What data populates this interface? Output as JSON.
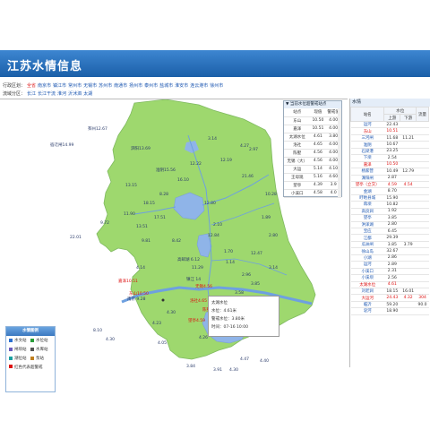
{
  "app": {
    "title": "江苏水情信息"
  },
  "nav": {
    "region_label": "行政区划：",
    "regions": [
      "全省",
      "南京市",
      "镇江市",
      "常州市",
      "无锡市",
      "苏州市",
      "南通市",
      "扬州市",
      "泰州市",
      "盐城市",
      "淮安市",
      "连云港市",
      "徐州市"
    ],
    "active_region": "全省",
    "basin_label": "流域分区：",
    "basins": [
      "长江",
      "长江干流",
      "淮河",
      "沂沭泗",
      "太湖"
    ]
  },
  "popup": {
    "title": "▼ 当前水位超警戒站点",
    "headers": [
      "站点",
      "现值",
      "警戒值"
    ],
    "rows": [
      [
        "东山",
        "10.50",
        "4.00"
      ],
      [
        "嘉泽",
        "10.51",
        "4.00"
      ],
      [
        "太湖水位",
        "4.61",
        "3.80"
      ],
      [
        "洛社",
        "4.65",
        "4.00"
      ],
      [
        "陈墅",
        "4.56",
        "4.00"
      ],
      [
        "无锡（大）",
        "4.56",
        "4.00"
      ],
      [
        "大运",
        "5.14",
        "4.10"
      ],
      [
        "王母观",
        "5.16",
        "4.60"
      ],
      [
        "望亭",
        "4.39",
        "3.9"
      ],
      [
        "小溪口",
        "4.58",
        "4.0"
      ]
    ]
  },
  "tooltip": {
    "name": "太湖水位",
    "level_label": "水位：",
    "level": "4.61米",
    "warn_label": "警戒水位：",
    "warn": "3.80米",
    "time_label": "时间：",
    "time": "07-16 10:00"
  },
  "legend": {
    "title": "水情图例",
    "items": [
      {
        "label": "水文站",
        "color": "#2a6fd0"
      },
      {
        "label": "水位站",
        "color": "#2a9d3a"
      },
      {
        "label": "闸坝站",
        "color": "#6a5bbd"
      },
      {
        "label": "水库站",
        "color": "#555555"
      },
      {
        "label": "潮位站",
        "color": "#1aa0a0"
      },
      {
        "label": "泵站",
        "color": "#c08020"
      }
    ],
    "note": "红色代表超警戒"
  },
  "sidebar": {
    "title": "水情",
    "headers": [
      "站名",
      "水位",
      "上游",
      "下游",
      "流量"
    ],
    "rows": [
      {
        "name": "运河",
        "up": "22.43",
        "down": "",
        "flow": "",
        "red": false
      },
      {
        "name": "东山",
        "up": "10.51",
        "down": "",
        "flow": "",
        "red": true
      },
      {
        "name": "三河闸",
        "up": "11.68",
        "down": "11.21",
        "flow": "",
        "red": false
      },
      {
        "name": "淮阴",
        "up": "10.67",
        "down": "",
        "flow": "",
        "red": false
      },
      {
        "name": "石梁港",
        "up": "23.25",
        "down": "",
        "flow": "",
        "red": false
      },
      {
        "name": "下坝",
        "up": "2.54",
        "down": "",
        "flow": "",
        "red": false
      },
      {
        "name": "嘉泽",
        "up": "10.50",
        "down": "",
        "flow": "",
        "red": true
      },
      {
        "name": "杨家营",
        "up": "10.49",
        "down": "12.79",
        "flow": "",
        "red": false
      },
      {
        "name": "溧阳闸",
        "up": "2.87",
        "down": "",
        "flow": "",
        "red": false
      },
      {
        "name": "望亭（立交）",
        "up": "4.59",
        "down": "4.54",
        "flow": "",
        "red": true
      },
      {
        "name": "金湖",
        "up": "8.70",
        "down": "",
        "flow": "",
        "red": false
      },
      {
        "name": "盱眙县城",
        "up": "15.90",
        "down": "",
        "flow": "",
        "red": false
      },
      {
        "name": "蒋坝",
        "up": "10.82",
        "down": "",
        "flow": "",
        "red": false
      },
      {
        "name": "高良涧",
        "up": "1.92",
        "down": "",
        "flow": "",
        "red": false
      },
      {
        "name": "望亭",
        "up": "3.85",
        "down": "",
        "flow": "",
        "red": false
      },
      {
        "name": "洪泽湖",
        "up": "2.80",
        "down": "",
        "flow": "",
        "red": false
      },
      {
        "name": "宝应",
        "up": "6.45",
        "down": "",
        "flow": "",
        "red": false
      },
      {
        "name": "江都",
        "up": "29.39",
        "down": "",
        "flow": "",
        "red": false
      },
      {
        "name": "瓜洲闸",
        "up": "3.85",
        "down": "3.79",
        "flow": "",
        "red": false
      },
      {
        "name": "徐山岛",
        "up": "32.67",
        "down": "",
        "flow": "",
        "red": false
      },
      {
        "name": "小湖",
        "up": "2.86",
        "down": "",
        "flow": "",
        "red": false
      },
      {
        "name": "运河",
        "up": "2.89",
        "down": "",
        "flow": "",
        "red": false
      },
      {
        "name": "小溪口",
        "up": "2.31",
        "down": "",
        "flow": "",
        "red": false
      },
      {
        "name": "小溪坝",
        "up": "2.56",
        "down": "",
        "flow": "",
        "red": false
      },
      {
        "name": "太湖水位",
        "up": "4.61",
        "down": "",
        "flow": "",
        "red": true
      },
      {
        "name": "刘老涧",
        "up": "18.15",
        "down": "16.01",
        "flow": "",
        "red": false
      },
      {
        "name": "大运河",
        "up": "24.43",
        "down": "4.32",
        "flow": "304",
        "red": true
      },
      {
        "name": "临沂",
        "up": "59.20",
        "down": "",
        "flow": "90.0",
        "red": false
      },
      {
        "name": "皂河",
        "up": "18.90",
        "down": "",
        "flow": "",
        "red": false
      }
    ]
  },
  "map_labels": [
    {
      "text": "邳州12.67",
      "red": false
    },
    {
      "text": "宿迁闸14.99",
      "red": false
    },
    {
      "text": "3.14",
      "red": false
    },
    {
      "text": "4.27",
      "red": false
    },
    {
      "text": "12.19",
      "red": false
    },
    {
      "text": "2.97",
      "red": false
    },
    {
      "text": "泗阳13.69",
      "red": false
    },
    {
      "text": "12.22",
      "red": false
    },
    {
      "text": "淮阴15.56",
      "red": false
    },
    {
      "text": "16.10",
      "red": false
    },
    {
      "text": "21.46",
      "red": false
    },
    {
      "text": "13.15",
      "red": false
    },
    {
      "text": "8.28",
      "red": false
    },
    {
      "text": "18.15",
      "red": false
    },
    {
      "text": "12.80",
      "red": false
    },
    {
      "text": "10.28",
      "red": false
    },
    {
      "text": "11.90",
      "red": false
    },
    {
      "text": "17.51",
      "red": false
    },
    {
      "text": "13.51",
      "red": false
    },
    {
      "text": "2.10",
      "red": false
    },
    {
      "text": "1.89",
      "red": false
    },
    {
      "text": "12.84",
      "red": false
    },
    {
      "text": "9.72",
      "red": false
    },
    {
      "text": "9.81",
      "red": false
    },
    {
      "text": "8.42",
      "red": false
    },
    {
      "text": "2.80",
      "red": false
    },
    {
      "text": "22.01",
      "red": false
    },
    {
      "text": "高邮湖 6.12",
      "red": false
    },
    {
      "text": "1.70",
      "red": false
    },
    {
      "text": "1.14",
      "red": false
    },
    {
      "text": "4.14",
      "red": false
    },
    {
      "text": "11.29",
      "red": false
    },
    {
      "text": "12.47",
      "red": false
    },
    {
      "text": "3.14",
      "red": false
    },
    {
      "text": "2.96",
      "red": false
    },
    {
      "text": "3.85",
      "red": false
    },
    {
      "text": "3.58",
      "red": false
    },
    {
      "text": "南京 9.28",
      "red": false
    },
    {
      "text": "镇江 14",
      "red": false
    },
    {
      "text": "嘉泽10.51",
      "red": true
    },
    {
      "text": "东山10.50",
      "red": true
    },
    {
      "text": "无锡4.56",
      "red": true
    },
    {
      "text": "洛社4.65",
      "red": true
    },
    {
      "text": "陈墅4.56",
      "red": true
    },
    {
      "text": "望亭4.59",
      "red": true
    },
    {
      "text": "大运河5.14",
      "red": true
    },
    {
      "text": "王母观5.16",
      "red": true
    },
    {
      "text": "3.68",
      "red": false
    },
    {
      "text": "8.10",
      "red": false
    },
    {
      "text": "4.30",
      "red": false
    },
    {
      "text": "3.42",
      "red": false
    },
    {
      "text": "3.93",
      "red": false
    },
    {
      "text": "2.95",
      "red": false
    },
    {
      "text": "4.47",
      "red": false
    },
    {
      "text": "4.40",
      "red": false
    },
    {
      "text": "3.84",
      "red": false
    },
    {
      "text": "4.26",
      "red": false
    },
    {
      "text": "4.23",
      "red": false
    },
    {
      "text": "4.30",
      "red": false
    },
    {
      "text": "4.05",
      "red": false
    },
    {
      "text": "3.91",
      "red": false
    },
    {
      "text": "4.30",
      "red": false
    }
  ]
}
